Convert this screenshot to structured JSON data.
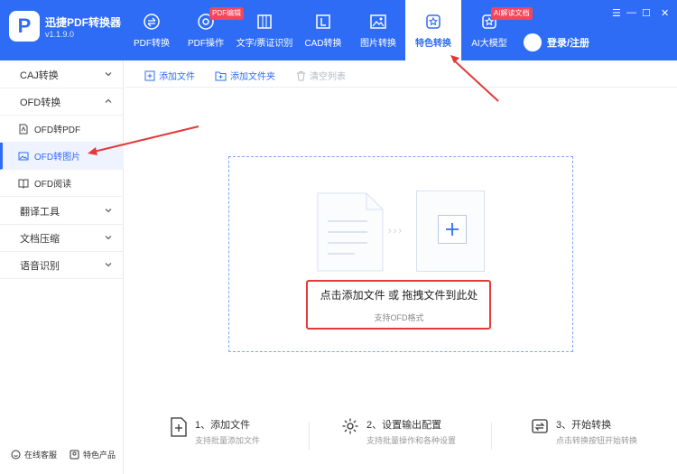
{
  "app": {
    "name": "迅捷PDF转换器",
    "version": "v1.1.9.0",
    "logo_glyph": "P"
  },
  "tabs": [
    {
      "label": "PDF转换",
      "icon": "convert-icon"
    },
    {
      "label": "PDF操作",
      "icon": "pdf-op-icon",
      "badge": "PDF编辑"
    },
    {
      "label": "文字/票证识别",
      "icon": "ocr-icon"
    },
    {
      "label": "CAD转换",
      "icon": "cad-icon"
    },
    {
      "label": "图片转换",
      "icon": "image-icon"
    },
    {
      "label": "特色转换",
      "icon": "star-icon",
      "active": true
    },
    {
      "label": "AI大模型",
      "icon": "ai-icon",
      "badge": "AI解读文档"
    }
  ],
  "login": {
    "label": "登录/注册",
    "avatar_glyph": "☺"
  },
  "window_controls": {
    "menu": "☰",
    "minimize": "—",
    "maximize": "☐",
    "close": "✕"
  },
  "sidebar": {
    "groups": [
      {
        "label": "CAJ转换",
        "expanded": false
      },
      {
        "label": "OFD转换",
        "expanded": true
      },
      {
        "label": "翻译工具",
        "expanded": false
      },
      {
        "label": "文档压缩",
        "expanded": false
      },
      {
        "label": "语音识别",
        "expanded": false
      }
    ],
    "items": [
      {
        "label": "OFD转PDF",
        "icon": "pdf-file-icon"
      },
      {
        "label": "OFD转图片",
        "icon": "picture-icon",
        "active": true
      },
      {
        "label": "OFD阅读",
        "icon": "book-icon"
      }
    ],
    "footer": {
      "service": "在线客服",
      "products": "特色产品"
    }
  },
  "toolbar": {
    "add_file": "添加文件",
    "add_folder": "添加文件夹",
    "clear_list": "清空列表"
  },
  "dropzone": {
    "title": "点击添加文件 或 拖拽文件到此处",
    "subtitle": "支持OFD格式",
    "arrows": "›››"
  },
  "steps": [
    {
      "title": "1、添加文件",
      "desc": "支持批量添加文件"
    },
    {
      "title": "2、设置输出配置",
      "desc": "支持批量操作和各种设置"
    },
    {
      "title": "3、开始转换",
      "desc": "点击转换按钮开始转换"
    }
  ],
  "colors": {
    "brand": "#2f6cf6",
    "annotation": "#e23a3a",
    "badge": "#f5455c"
  }
}
